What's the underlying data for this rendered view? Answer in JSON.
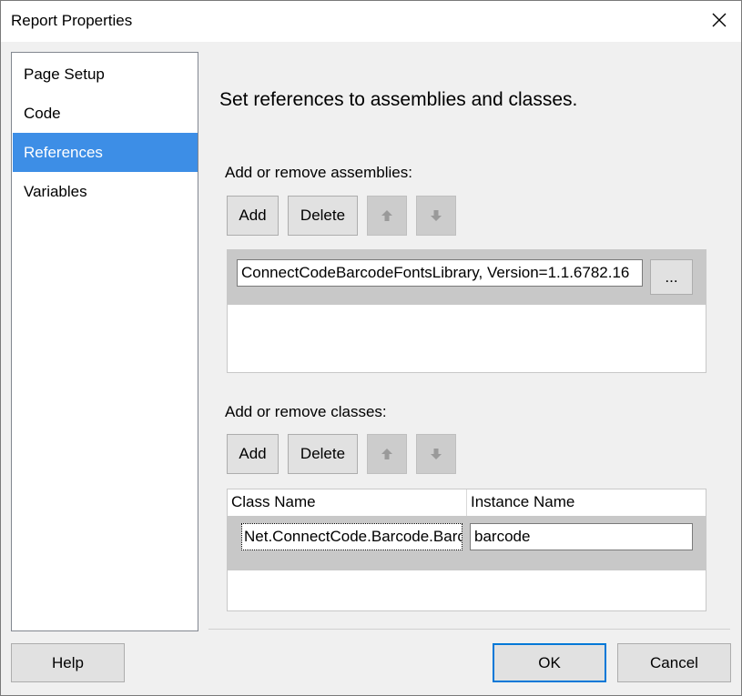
{
  "window": {
    "title": "Report Properties"
  },
  "nav": {
    "items": [
      {
        "label": "Page Setup"
      },
      {
        "label": "Code"
      },
      {
        "label": "References",
        "selected": true
      },
      {
        "label": "Variables"
      }
    ]
  },
  "main": {
    "heading": "Set references to assemblies and classes.",
    "assemblies": {
      "label": "Add or remove assemblies:",
      "add_label": "Add",
      "delete_label": "Delete",
      "entry_value": "ConnectCodeBarcodeFontsLibrary, Version=1.1.6782.16",
      "browse_label": "..."
    },
    "classes": {
      "label": "Add or remove classes:",
      "add_label": "Add",
      "delete_label": "Delete",
      "columns": [
        "Class Name",
        "Instance Name"
      ],
      "rows": [
        {
          "class_name": "Net.ConnectCode.Barcode.Barc",
          "instance_name": "barcode"
        }
      ]
    }
  },
  "footer": {
    "help_label": "Help",
    "ok_label": "OK",
    "cancel_label": "Cancel"
  },
  "colors": {
    "selection": "#3d8ee6",
    "default_button_border": "#0078d7"
  }
}
